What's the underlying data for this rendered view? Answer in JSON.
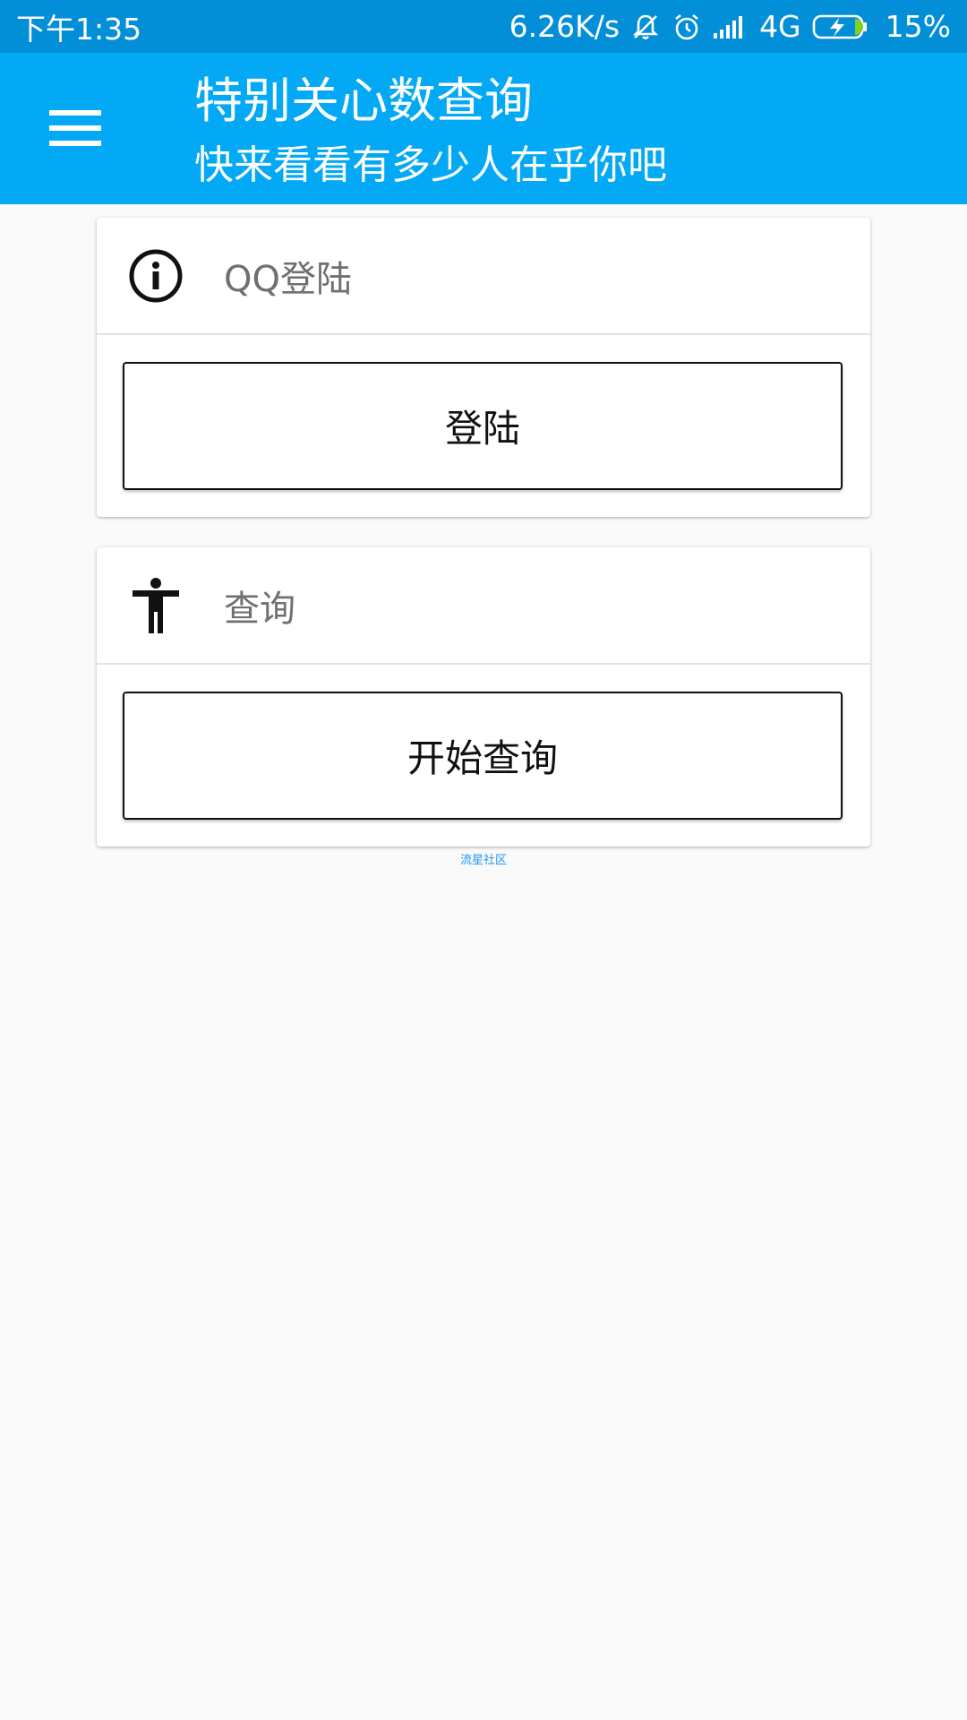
{
  "status_bar": {
    "time": "下午1:35",
    "network_speed": "6.26K/s",
    "network_type": "4G",
    "battery_percent": "15%",
    "icons": [
      "bell-mute-icon",
      "alarm-icon",
      "signal-icon",
      "battery-charging-icon"
    ]
  },
  "app_bar": {
    "title": "特别关心数查询",
    "subtitle": "快来看看有多少人在乎你吧",
    "menu_icon": "menu-icon"
  },
  "cards": [
    {
      "title": "QQ登陆",
      "icon": "info-icon",
      "button_label": "登陆"
    },
    {
      "title": "查询",
      "icon": "accessibility-person-icon",
      "button_label": "开始查询"
    }
  ],
  "footer": {
    "link_text": "流星社区"
  },
  "colors": {
    "status_bar_bg": "#028fd8",
    "app_bar_bg": "#03a9f4",
    "page_bg": "#fafafa",
    "link": "#2196f3"
  }
}
